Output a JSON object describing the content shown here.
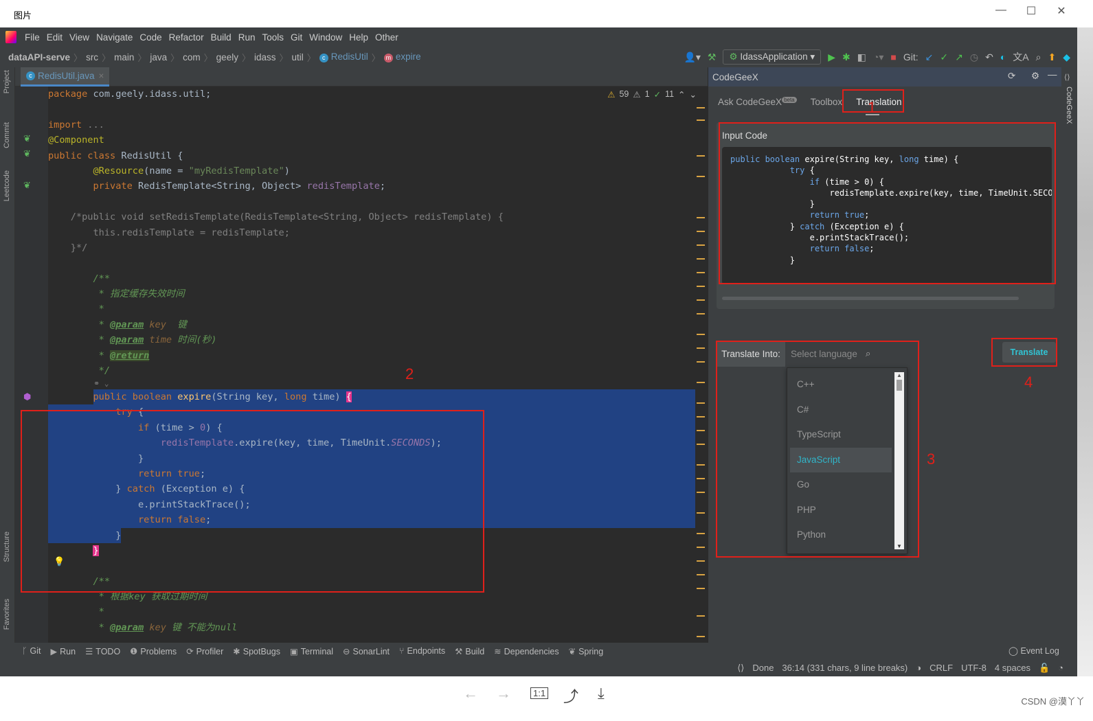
{
  "window": {
    "title": "图片"
  },
  "menu": [
    "File",
    "Edit",
    "View",
    "Navigate",
    "Code",
    "Refactor",
    "Build",
    "Run",
    "Tools",
    "Git",
    "Window",
    "Help",
    "Other"
  ],
  "breadcrumb": [
    "dataAPI-serve",
    "src",
    "main",
    "java",
    "com",
    "geely",
    "idass",
    "util",
    "RedisUtil",
    "expire"
  ],
  "toolbar": {
    "run_config": "IdassApplication",
    "git_label": "Git:"
  },
  "editor_tab": "RedisUtil.java",
  "inspections": {
    "warnings": "59",
    "weak_warnings": "1",
    "ok": "11"
  },
  "left_tool_tabs": [
    "Project",
    "Commit",
    "Leetcode",
    "Structure",
    "Favorites"
  ],
  "code_lines": [
    [
      [
        "kw",
        "package "
      ],
      [
        "",
        "com.geely.idass.util;"
      ]
    ],
    [],
    [
      [
        "kw",
        "import "
      ],
      [
        "cm",
        "..."
      ]
    ],
    [
      [
        "an",
        "@Component"
      ]
    ],
    [
      [
        "kw",
        "public class "
      ],
      [
        "",
        "RedisUtil {"
      ]
    ],
    [
      [
        "",
        "        "
      ],
      [
        "an",
        "@Resource"
      ],
      [
        "",
        "(name = "
      ],
      [
        "st",
        "\"myRedisTemplate\""
      ],
      [
        "",
        ")"
      ]
    ],
    [
      [
        "",
        "        "
      ],
      [
        "kw",
        "private "
      ],
      [
        "",
        "RedisTemplate<String, Object> "
      ],
      [
        "fd",
        "redisTemplate"
      ],
      [
        "",
        ";"
      ]
    ],
    [],
    [
      [
        "cm",
        "    /*public void setRedisTemplate(RedisTemplate<String, Object> redisTemplate) {"
      ]
    ],
    [
      [
        "cm",
        "        this.redisTemplate = redisTemplate;"
      ]
    ],
    [
      [
        "cm",
        "    }*/"
      ]
    ],
    [],
    [
      [
        "dc",
        "        /**"
      ]
    ],
    [
      [
        "dc",
        "         * 指定缓存失效时间"
      ]
    ],
    [
      [
        "dc",
        "         *"
      ]
    ],
    [
      [
        "dc",
        "         * "
      ],
      [
        "dt",
        "@param"
      ],
      [
        "dp",
        " key"
      ],
      [
        "dc",
        "  键"
      ]
    ],
    [
      [
        "dc",
        "         * "
      ],
      [
        "dt",
        "@param"
      ],
      [
        "dp",
        " time"
      ],
      [
        "dc",
        " 时间(秒)"
      ]
    ],
    [
      [
        "dc",
        "         * "
      ],
      [
        "dt dr",
        "@return"
      ]
    ],
    [
      [
        "dc",
        "         */"
      ]
    ],
    "HINT",
    [
      [
        "",
        "        "
      ],
      [
        "kw",
        "public boolean "
      ],
      [
        "mt",
        "expire"
      ],
      [
        "",
        "(String key, "
      ],
      [
        "kw",
        "long "
      ],
      [
        "",
        "time) "
      ],
      [
        "br",
        "{"
      ]
    ],
    [
      [
        "",
        "            "
      ],
      [
        "kw",
        "try "
      ],
      [
        "",
        "{"
      ]
    ],
    [
      [
        "",
        "                "
      ],
      [
        "kw",
        "if "
      ],
      [
        "",
        "(time > "
      ],
      [
        "fd",
        "0"
      ],
      [
        "",
        ") {"
      ]
    ],
    [
      [
        "",
        "                    "
      ],
      [
        "fd",
        "redisTemplate"
      ],
      [
        "",
        ".expire(key, time, TimeUnit."
      ],
      [
        "it",
        "SECONDS"
      ],
      [
        "",
        ");"
      ]
    ],
    [
      [
        "",
        "                }"
      ]
    ],
    [
      [
        "",
        "                "
      ],
      [
        "kw",
        "return true"
      ],
      [
        "",
        ";"
      ]
    ],
    [
      [
        "",
        "            } "
      ],
      [
        "kw",
        "catch "
      ],
      [
        "",
        "(Exception e) {"
      ]
    ],
    [
      [
        "",
        "                e.printStackTrace();"
      ]
    ],
    [
      [
        "",
        "                "
      ],
      [
        "kw",
        "return false"
      ],
      [
        "",
        ";"
      ]
    ],
    [
      [
        "",
        "            }"
      ]
    ],
    [
      [
        "",
        "        "
      ],
      [
        "br",
        "}"
      ]
    ],
    [],
    [
      [
        "dc",
        "        /**"
      ]
    ],
    [
      [
        "dc",
        "         * 根据key 获取过期时间"
      ]
    ],
    [
      [
        "dc",
        "         *"
      ]
    ],
    [
      [
        "dc",
        "         * "
      ],
      [
        "dt",
        "@param"
      ],
      [
        "dp",
        " key"
      ],
      [
        "dc",
        " 键 不能为null"
      ]
    ]
  ],
  "code_hint": "⚭ ⌄",
  "annotations": [
    "1",
    "2",
    "3",
    "4"
  ],
  "codegeex": {
    "title": "CodeGeeX",
    "tabs": [
      {
        "label": "Ask CodeGeeX",
        "badge": "beta"
      },
      {
        "label": "Toolbox"
      },
      {
        "label": "Translation",
        "active": true
      }
    ],
    "input_label": "Input Code",
    "input_code": [
      [
        [
          "k",
          "public boolean "
        ],
        [
          "",
          "expire(String key, "
        ],
        [
          "k",
          "long "
        ],
        [
          "",
          "time) {"
        ]
      ],
      [
        [
          "",
          "            "
        ],
        [
          "k",
          "try "
        ],
        [
          "",
          "{"
        ]
      ],
      [
        [
          "",
          "                "
        ],
        [
          "k",
          "if "
        ],
        [
          "",
          "(time > 0) {"
        ]
      ],
      [
        [
          "",
          "                    redisTemplate.expire(key, time, TimeUnit.SECONDS);"
        ]
      ],
      [
        [
          "",
          "                }"
        ]
      ],
      [
        [
          "",
          "                "
        ],
        [
          "k",
          "return true"
        ],
        [
          "",
          ";"
        ]
      ],
      [
        [
          "",
          "            } "
        ],
        [
          "k",
          "catch "
        ],
        [
          "",
          "(Exception e) {"
        ]
      ],
      [
        [
          "",
          "                e.printStackTrace();"
        ]
      ],
      [
        [
          "",
          "                "
        ],
        [
          "k",
          "return false"
        ],
        [
          "",
          ";"
        ]
      ],
      [
        [
          "",
          "            }"
        ]
      ]
    ],
    "translate_into_label": "Translate Into:",
    "language_placeholder": "Select language",
    "languages": [
      "C++",
      "C#",
      "TypeScript",
      "JavaScript",
      "Go",
      "PHP",
      "Python"
    ],
    "selected_language": "JavaScript",
    "translate_button": "Translate"
  },
  "bottom_tools": [
    "Git",
    "Run",
    "TODO",
    "Problems",
    "Profiler",
    "SpotBugs",
    "Terminal",
    "SonarLint",
    "Endpoints",
    "Build",
    "Dependencies",
    "Spring"
  ],
  "event_log": "Event Log",
  "status": {
    "task": "Done",
    "position": "36:14 (331 chars, 9 line breaks)",
    "line_sep": "CRLF",
    "encoding": "UTF-8",
    "indent": "4 spaces"
  },
  "watermark": "CSDN @漠丫丫",
  "colors": {
    "selection": "#214283",
    "keyword": "#cc7832",
    "annotation_box": "#e0201a",
    "accent": "#31b5c9"
  }
}
